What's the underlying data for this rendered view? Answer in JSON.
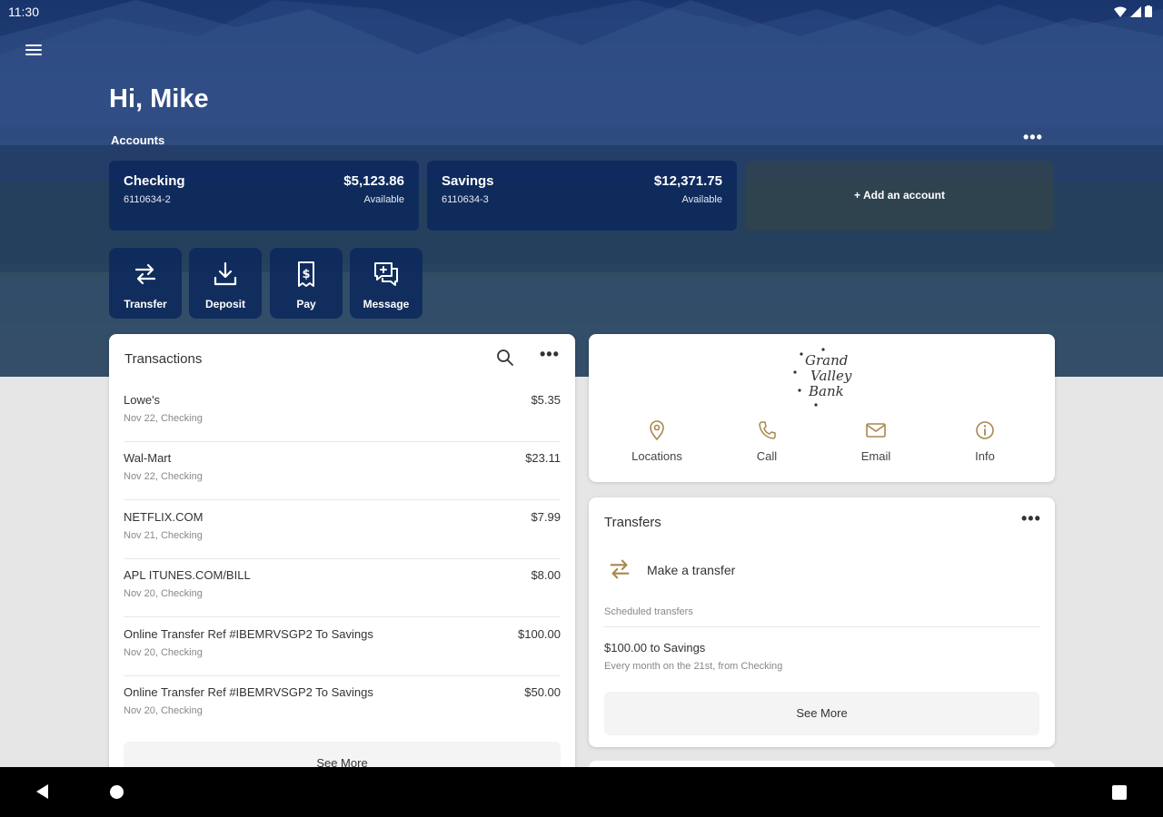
{
  "status_bar": {
    "time": "11:30"
  },
  "header": {
    "greeting": "Hi, Mike",
    "accounts_label": "Accounts"
  },
  "accounts": [
    {
      "name": "Checking",
      "number": "6110634-2",
      "balance": "$5,123.86",
      "balance_label": "Available"
    },
    {
      "name": "Savings",
      "number": "6110634-3",
      "balance": "$12,371.75",
      "balance_label": "Available"
    }
  ],
  "add_account_label": "+ Add an account",
  "quick_actions": [
    {
      "label": "Transfer",
      "icon": "transfer-icon"
    },
    {
      "label": "Deposit",
      "icon": "deposit-icon"
    },
    {
      "label": "Pay",
      "icon": "pay-icon"
    },
    {
      "label": "Message",
      "icon": "message-icon"
    }
  ],
  "transactions": {
    "title": "Transactions",
    "items": [
      {
        "description": "Lowe's",
        "meta": "Nov 22, Checking",
        "amount": "$5.35"
      },
      {
        "description": "Wal-Mart",
        "meta": "Nov 22, Checking",
        "amount": "$23.11"
      },
      {
        "description": "NETFLIX.COM",
        "meta": "Nov 21, Checking",
        "amount": "$7.99"
      },
      {
        "description": "APL ITUNES.COM/BILL",
        "meta": "Nov 20, Checking",
        "amount": "$8.00"
      },
      {
        "description": "Online Transfer Ref #IBEMRVSGP2 To Savings",
        "meta": "Nov 20, Checking",
        "amount": "$100.00"
      },
      {
        "description": "Online Transfer Ref #IBEMRVSGP2 To Savings",
        "meta": "Nov 20, Checking",
        "amount": "$50.00"
      }
    ],
    "see_more": "See More"
  },
  "bank": {
    "logo_text": [
      "Grand",
      "Valley",
      "Bank"
    ],
    "contacts": [
      {
        "label": "Locations",
        "icon": "location-pin-icon"
      },
      {
        "label": "Call",
        "icon": "phone-icon"
      },
      {
        "label": "Email",
        "icon": "email-icon"
      },
      {
        "label": "Info",
        "icon": "info-icon"
      }
    ]
  },
  "transfers": {
    "title": "Transfers",
    "make_transfer": "Make a transfer",
    "scheduled_label": "Scheduled transfers",
    "scheduled": [
      {
        "title": "$100.00 to Savings",
        "subtitle": "Every month on the 21st, from Checking"
      }
    ],
    "see_more": "See More"
  },
  "colors": {
    "brand_navy": "#0c285c",
    "accent_gold": "#a8874f",
    "background": "#e6e6e6"
  }
}
